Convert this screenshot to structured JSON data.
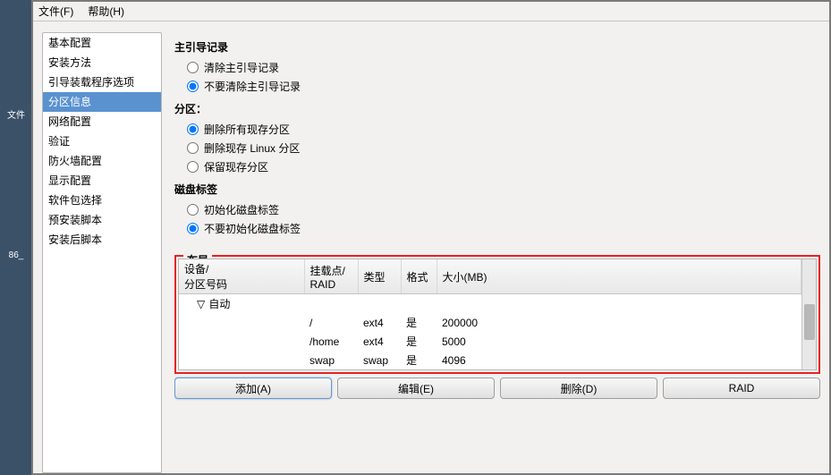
{
  "desktop": {
    "icon1": "文件",
    "icon2": "86_"
  },
  "menubar": {
    "file": "文件(F)",
    "help": "帮助(H)"
  },
  "sidebar": {
    "items": [
      {
        "label": "基本配置"
      },
      {
        "label": "安装方法"
      },
      {
        "label": "引导装载程序选项"
      },
      {
        "label": "分区信息"
      },
      {
        "label": "网络配置"
      },
      {
        "label": "验证"
      },
      {
        "label": "防火墙配置"
      },
      {
        "label": "显示配置"
      },
      {
        "label": "软件包选择"
      },
      {
        "label": "预安装脚本"
      },
      {
        "label": "安装后脚本"
      }
    ],
    "selected_index": 3
  },
  "sections": {
    "mbr": {
      "title": "主引导记录",
      "opt_clear": "清除主引导记录",
      "opt_noclear": "不要清除主引导记录"
    },
    "partition": {
      "title": "分区：",
      "opt_remove_all": "删除所有现存分区",
      "opt_remove_linux": "删除现存 Linux 分区",
      "opt_keep": "保留现存分区"
    },
    "disklabel": {
      "title": "磁盘标签",
      "opt_init": "初始化磁盘标签",
      "opt_noinit": "不要初始化磁盘标签"
    },
    "layout": {
      "title": "布局",
      "headers": {
        "device": "设备/\n分区号码",
        "mount": "挂载点/\nRAID",
        "type": "类型",
        "format": "格式",
        "size": "大小(MB)"
      },
      "auto_label": "自动",
      "rows": [
        {
          "mount": "/",
          "type": "ext4",
          "format": "是",
          "size": "200000"
        },
        {
          "mount": "/home",
          "type": "ext4",
          "format": "是",
          "size": "5000"
        },
        {
          "mount": "swap",
          "type": "swap",
          "format": "是",
          "size": "4096"
        }
      ]
    }
  },
  "buttons": {
    "add": "添加(A)",
    "edit": "编辑(E)",
    "delete": "删除(D)",
    "raid": "RAID"
  }
}
